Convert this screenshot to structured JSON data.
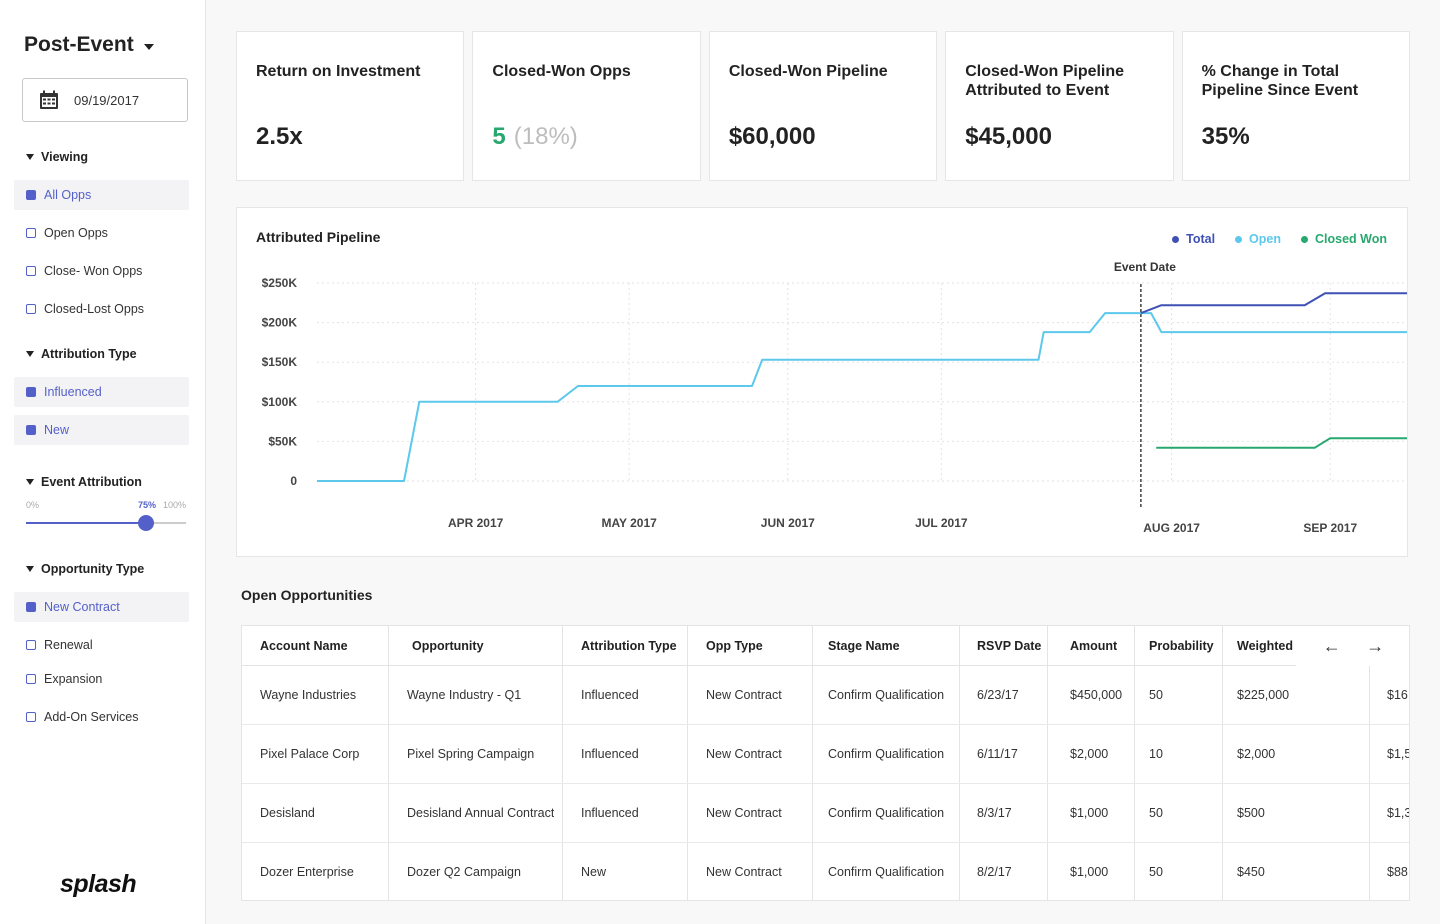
{
  "sidebar": {
    "title": "Post-Event",
    "date": "09/19/2017",
    "viewing": {
      "label": "Viewing",
      "items": [
        {
          "label": "All Opps",
          "checked": true
        },
        {
          "label": "Open Opps",
          "checked": false
        },
        {
          "label": "Close- Won Opps",
          "checked": false
        },
        {
          "label": "Closed-Lost Opps",
          "checked": false
        }
      ]
    },
    "attribution_type": {
      "label": "Attribution Type",
      "items": [
        {
          "label": "Influenced",
          "checked": true
        },
        {
          "label": "New",
          "checked": true
        }
      ]
    },
    "event_attribution": {
      "label": "Event Attribution",
      "min_label": "0%",
      "value_label": "75%",
      "max_label": "100%",
      "value": 75
    },
    "opportunity_type": {
      "label": "Opportunity Type",
      "items": [
        {
          "label": "New Contract",
          "checked": true
        },
        {
          "label": "Renewal",
          "checked": false
        },
        {
          "label": "Expansion",
          "checked": false
        },
        {
          "label": "Add-On Services",
          "checked": false
        }
      ]
    },
    "logo": "splash"
  },
  "kpis": [
    {
      "label": "Return on Investment",
      "value": "2.5x"
    },
    {
      "label": "Closed-Won Opps",
      "value": "5",
      "sub": "(18%)"
    },
    {
      "label": "Closed-Won Pipeline",
      "value": "$60,000"
    },
    {
      "label": "Closed-Won Pipeline Attributed to Event",
      "value": "$45,000"
    },
    {
      "label": "% Change in Total Pipeline Since Event",
      "value": "35%"
    }
  ],
  "chart": {
    "title": "Attributed Pipeline",
    "event_label": "Event Date",
    "colors": {
      "total": "#3f51b5",
      "open": "#5bc8ec",
      "closed_won": "#27a86e"
    }
  },
  "chart_data": {
    "type": "line",
    "title": "Attributed Pipeline",
    "xlabel": "",
    "ylabel": "",
    "x_ticks": [
      "APR 2017",
      "MAY 2017",
      "JUN 2017",
      "JUL 2017",
      "AUG 2017",
      "SEP 2017"
    ],
    "y_ticks": [
      "$250K",
      "$200K",
      "$150K",
      "$100K",
      "$50K",
      "0"
    ],
    "y_tick_values": [
      250000,
      200000,
      150000,
      100000,
      50000,
      0
    ],
    "ylim": [
      0,
      250000
    ],
    "x_range": [
      "2017-03-01",
      "2017-09-30"
    ],
    "event_date": "2017-08-09",
    "event_label": "Event Date",
    "grid": true,
    "legend": "top-right",
    "series": [
      {
        "name": "Total",
        "color": "#3f51b5",
        "points": [
          [
            "2017-08-09",
            212000
          ],
          [
            "2017-08-13",
            222000
          ],
          [
            "2017-09-10",
            222000
          ],
          [
            "2017-09-14",
            237000
          ],
          [
            "2017-09-30",
            237000
          ]
        ]
      },
      {
        "name": "Open",
        "color": "#5bc8ec",
        "points": [
          [
            "2017-03-01",
            0
          ],
          [
            "2017-03-18",
            0
          ],
          [
            "2017-03-21",
            100000
          ],
          [
            "2017-04-17",
            100000
          ],
          [
            "2017-04-21",
            120000
          ],
          [
            "2017-05-25",
            120000
          ],
          [
            "2017-05-27",
            153000
          ],
          [
            "2017-07-20",
            153000
          ],
          [
            "2017-07-21",
            188000
          ],
          [
            "2017-07-30",
            188000
          ],
          [
            "2017-08-02",
            212000
          ],
          [
            "2017-08-11",
            212000
          ],
          [
            "2017-08-13",
            188000
          ],
          [
            "2017-09-30",
            188000
          ]
        ]
      },
      {
        "name": "Closed Won",
        "color": "#27a86e",
        "points": [
          [
            "2017-08-12",
            42000
          ],
          [
            "2017-09-12",
            42000
          ],
          [
            "2017-09-15",
            54000
          ],
          [
            "2017-09-30",
            54000
          ]
        ]
      }
    ]
  },
  "table": {
    "title": "Open Opportunities",
    "columns": [
      "Account Name",
      "Opportunity",
      "Attribution Type",
      "Opp Type",
      "Stage Name",
      "RSVP Date",
      "Amount",
      "Probability",
      "Weighted P"
    ],
    "rows": [
      [
        "Wayne Industries",
        "Wayne Industry - Q1",
        "Influenced",
        "New Contract",
        "Confirm Qualification",
        "6/23/17",
        "$450,000",
        "50",
        "$225,000",
        "$16"
      ],
      [
        "Pixel Palace Corp",
        "Pixel Spring Campaign",
        "Influenced",
        "New Contract",
        "Confirm Qualification",
        "6/11/17",
        "$2,000",
        "10",
        "$2,000",
        "$1,5"
      ],
      [
        "Desisland",
        "Desisland Annual Contract",
        "Influenced",
        "New Contract",
        "Confirm Qualification",
        "8/3/17",
        "$1,000",
        "50",
        "$500",
        "$1,3"
      ],
      [
        "Dozer Enterprise",
        "Dozer Q2 Campaign",
        "New",
        "New Contract",
        "Confirm Qualification",
        "8/2/17",
        "$1,000",
        "50",
        "$450",
        "$88"
      ]
    ],
    "prev_icon": "←",
    "next_icon": "→"
  }
}
